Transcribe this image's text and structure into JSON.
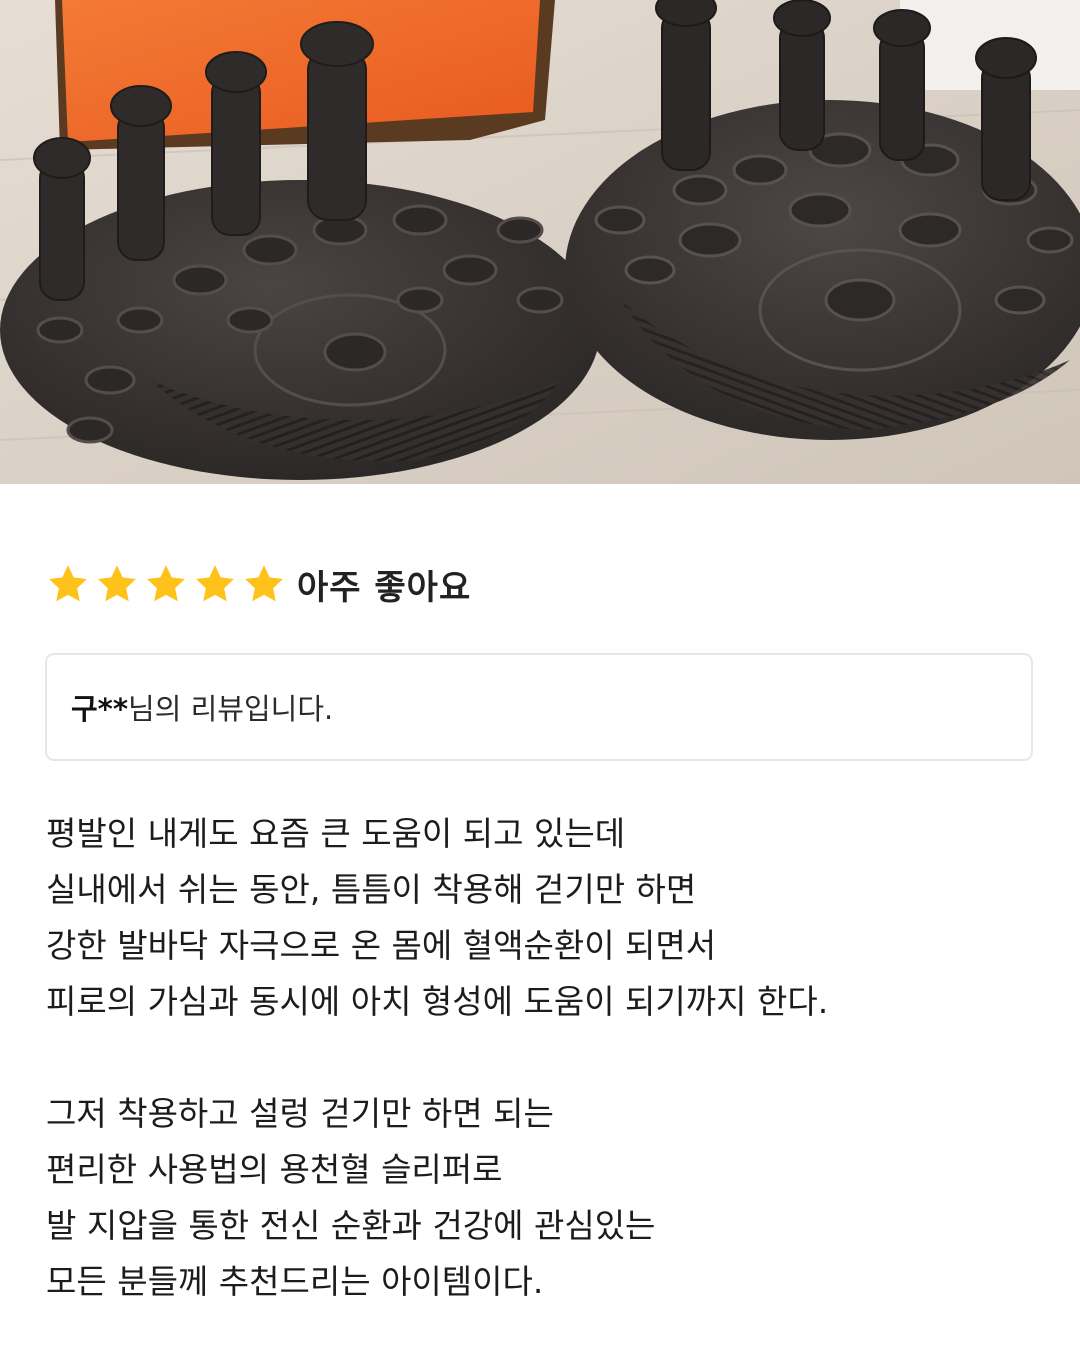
{
  "rating": {
    "stars": 5,
    "max_stars": 5,
    "label": "아주 좋아요",
    "star_color": "#ffc21a"
  },
  "reviewer": {
    "name": "구**",
    "suffix": "님의 리뷰입니다."
  },
  "review": {
    "paragraph_1": [
      "평발인 내게도 요즘 큰 도움이 되고 있는데",
      "실내에서 쉬는 동안, 틈틈이 착용해 걷기만 하면",
      "강한 발바닥 자극으로 온 몸에 혈액순환이 되면서",
      "피로의 가심과 동시에 아치 형성에 도움이 되기까지 한다."
    ],
    "paragraph_2": [
      "그저 착용하고 설렁 걷기만 하면 되는",
      "편리한 사용법의 용천혈 슬리퍼로",
      "발 지압을 통한 전신 순환과 건강에 관심있는",
      "모든 분들께 추천드리는 아이템이다."
    ]
  },
  "colors": {
    "box_orange": "#f06a2a",
    "product_dark": "#3a3533",
    "floor": "#d8cfc4"
  }
}
